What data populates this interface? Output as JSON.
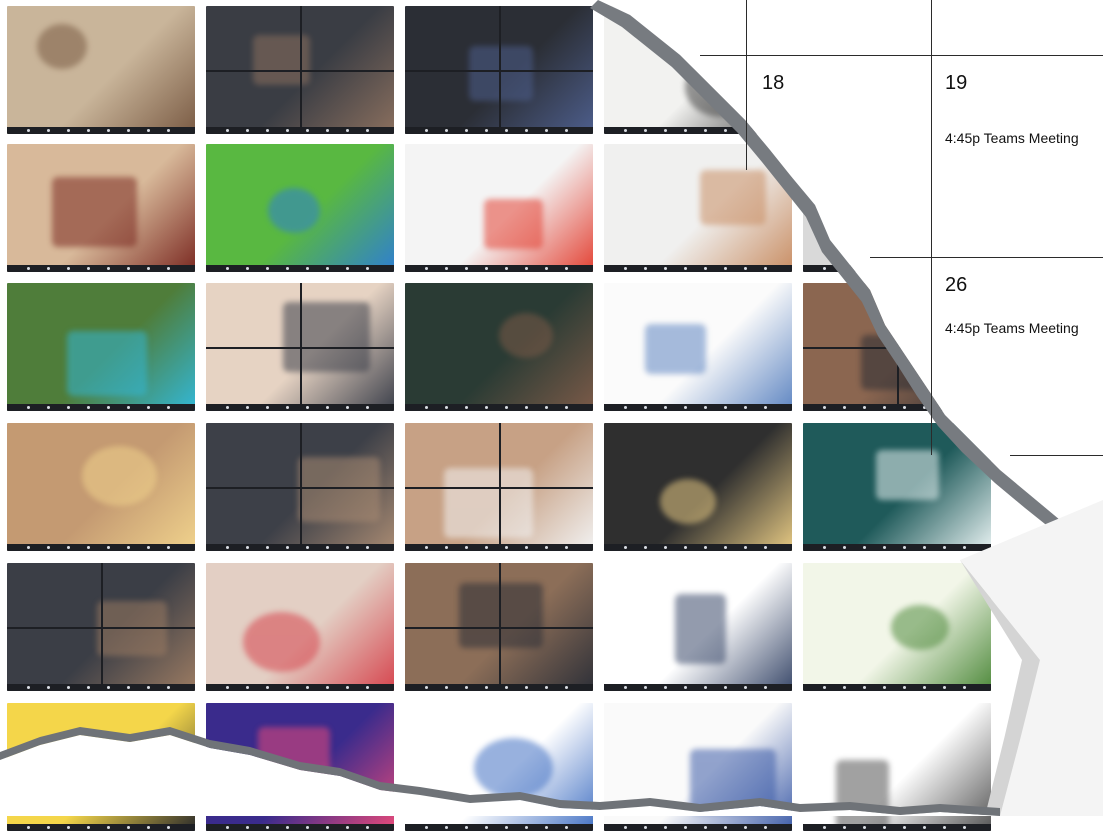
{
  "calendar": {
    "days": [
      {
        "number": "18"
      },
      {
        "number": "19",
        "event": "4:45p Teams Meeting"
      },
      {
        "number": "26",
        "event": "4:45p Teams Meeting"
      }
    ]
  },
  "thumbnails": [
    {
      "name": "thumb-guitar-student",
      "scene": "guitar player",
      "colors": [
        "#c9b59a",
        "#7a5b44"
      ]
    },
    {
      "name": "thumb-video-call-grid-a",
      "scene": "video call grid",
      "colors": [
        "#3a3d44",
        "#8a6f5e"
      ]
    },
    {
      "name": "thumb-video-call-grid-b",
      "scene": "video call grid",
      "colors": [
        "#2b2e35",
        "#4d5e8c"
      ]
    },
    {
      "name": "thumb-handwritten-notes-a",
      "scene": "handwritten notes",
      "colors": [
        "#f2f2f0",
        "#444"
      ]
    },
    {
      "name": "thumb-painting-art",
      "scene": "painting",
      "colors": [
        "#e9e3d8",
        "#b27a3a"
      ]
    },
    {
      "name": "thumb-mask-drawing",
      "scene": "mask drawing",
      "colors": [
        "#d8b99a",
        "#7b2a22"
      ]
    },
    {
      "name": "thumb-green-slide",
      "scene": "green slide",
      "colors": [
        "#59b841",
        "#2f7fd0"
      ]
    },
    {
      "name": "thumb-quiz-slide",
      "scene": "quiz slide",
      "colors": [
        "#f4f4f4",
        "#e34234"
      ]
    },
    {
      "name": "thumb-hand-writing",
      "scene": "hand writing",
      "colors": [
        "#f0f0ef",
        "#c98e64"
      ]
    },
    {
      "name": "thumb-speaker-mic",
      "scene": "speaker",
      "colors": [
        "#d9d9d9",
        "#1d2633"
      ]
    },
    {
      "name": "thumb-yoga-plank",
      "scene": "yoga outdoors",
      "colors": [
        "#4f7d3a",
        "#33b7d6"
      ]
    },
    {
      "name": "thumb-video-call-grid-c",
      "scene": "video call grid",
      "colors": [
        "#e6d3c3",
        "#3b3f4a"
      ]
    },
    {
      "name": "thumb-teacher-blackboard",
      "scene": "blackboard",
      "colors": [
        "#2a3b34",
        "#7b5a48"
      ]
    },
    {
      "name": "thumb-whiteboard-notes",
      "scene": "whiteboard",
      "colors": [
        "#fbfbfb",
        "#5f86c2"
      ]
    },
    {
      "name": "thumb-video-call-grid-d",
      "scene": "video call grid",
      "colors": [
        "#8b6650",
        "#2a2c33"
      ]
    },
    {
      "name": "thumb-teacher-model-house",
      "scene": "teacher with model",
      "colors": [
        "#c49a72",
        "#f0d28c"
      ]
    },
    {
      "name": "thumb-video-call-grid-e",
      "scene": "video call grid",
      "colors": [
        "#3d4048",
        "#a88a72"
      ]
    },
    {
      "name": "thumb-video-call-grid-f",
      "scene": "video call grid",
      "colors": [
        "#c7a185",
        "#f2f2f2"
      ]
    },
    {
      "name": "thumb-geography-slide",
      "scene": "slide with images",
      "colors": [
        "#2f2f2f",
        "#e6c983"
      ]
    },
    {
      "name": "thumb-teal-text-slide",
      "scene": "teal slide",
      "colors": [
        "#1f5a5a",
        "#e8f2f2"
      ]
    },
    {
      "name": "thumb-video-call-grid-g",
      "scene": "video call grid",
      "colors": [
        "#3b3e46",
        "#9b7b62"
      ]
    },
    {
      "name": "thumb-teacher-student-call",
      "scene": "two people call",
      "colors": [
        "#e3cfc4",
        "#d6454e"
      ]
    },
    {
      "name": "thumb-video-call-grid-h",
      "scene": "video call grid",
      "colors": [
        "#8c6e58",
        "#2e3038"
      ]
    },
    {
      "name": "thumb-document-page",
      "scene": "document",
      "colors": [
        "#ffffff",
        "#3b4a6b"
      ]
    },
    {
      "name": "thumb-spreadsheet",
      "scene": "spreadsheet",
      "colors": [
        "#f2f6e8",
        "#4f8a3c"
      ]
    },
    {
      "name": "thumb-yellow-number",
      "scene": "yellow slide",
      "colors": [
        "#f4d64a",
        "#2b2b2b"
      ]
    },
    {
      "name": "thumb-colorful-table",
      "scene": "color table",
      "colors": [
        "#3a2b8c",
        "#e74a7a"
      ]
    },
    {
      "name": "thumb-word-document",
      "scene": "word document",
      "colors": [
        "#ffffff",
        "#4472c4"
      ]
    },
    {
      "name": "thumb-handwritten-math",
      "scene": "math notes",
      "colors": [
        "#fafafa",
        "#3d5ca8"
      ]
    },
    {
      "name": "thumb-handwritten-notes-b",
      "scene": "handwritten notes",
      "colors": [
        "#ffffff",
        "#555555"
      ]
    }
  ]
}
